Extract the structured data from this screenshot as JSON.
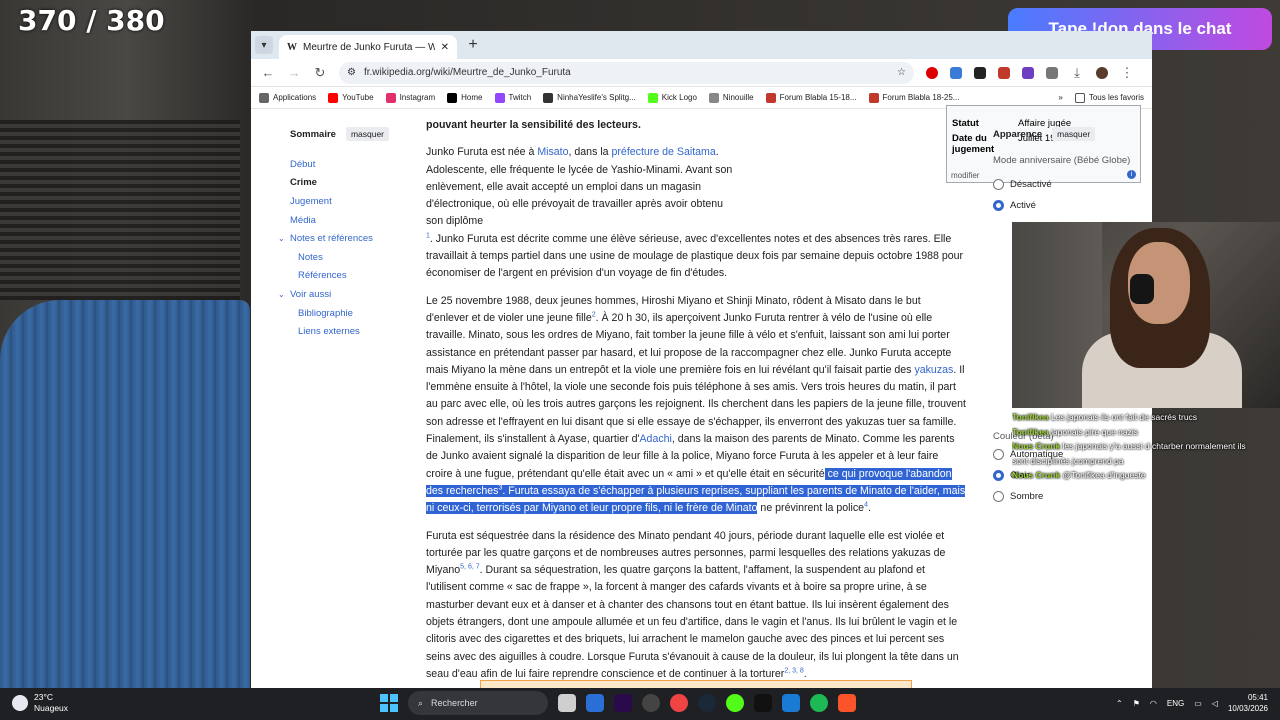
{
  "overlay": {
    "counter": "370 / 380",
    "alert": "Tape !don dans le chat"
  },
  "browser": {
    "tab_title": "Meurtre de Junko Furuta — Wi",
    "url": "fr.wikipedia.org/wiki/Meurtre_de_Junko_Furuta",
    "bookmarks": [
      {
        "label": "Applications",
        "color": "#666"
      },
      {
        "label": "YouTube",
        "color": "#ff0000"
      },
      {
        "label": "Instagram",
        "color": "#e1306c"
      },
      {
        "label": "Home",
        "color": "#000"
      },
      {
        "label": "Twitch",
        "color": "#9146ff"
      },
      {
        "label": "NinhaYeslife's Splitg...",
        "color": "#333"
      },
      {
        "label": "Kick Logo",
        "color": "#53fc18"
      },
      {
        "label": "Ninouille",
        "color": "#888"
      },
      {
        "label": "Forum Blabla 15-18...",
        "color": "#c0392b"
      },
      {
        "label": "Forum Blabla 18-25...",
        "color": "#c0392b"
      }
    ],
    "all_bookmarks": "Tous les favoris"
  },
  "toc": {
    "title": "Sommaire",
    "hide": "masquer",
    "items": [
      "Début",
      "Crime",
      "Jugement",
      "Média",
      "Notes et références",
      "Notes",
      "Références",
      "Voir aussi",
      "Bibliographie",
      "Liens externes"
    ]
  },
  "infobox": {
    "row1_label": "Statut",
    "row1_value": "Affaire jugée",
    "row2_label": "Date du jugement",
    "row2_value": "Juillet 1990",
    "edit": "modifier"
  },
  "article": {
    "warning": "pouvant heurter la sensibilité des lecteurs.",
    "p1": {
      "t1": "Junko Furuta est née à ",
      "l1": "Misato",
      "t2": ", dans la ",
      "l2": "préfecture de Saitama",
      "t3": ". Adolescente, elle fréquente le lycée de Yashio-Minami. Avant son enlèvement, elle avait accepté un emploi dans un magasin d'électronique, où elle prévoyait de travailler après avoir obtenu son diplôme",
      "r1": "1",
      "t4": ". Junko Furuta est décrite comme une élève sérieuse, avec d'excellentes notes et des absences très rares. Elle travaillait à temps partiel dans une usine de moulage de plastique deux fois par semaine depuis octobre 1988 pour économiser de l'argent en prévision d'un voyage de fin d'études."
    },
    "p2": {
      "t1": "Le 25 novembre 1988, deux jeunes hommes, Hiroshi Miyano et Shinji Minato, rôdent à Misato dans le but d'enlever et de violer une jeune fille",
      "r1": "2",
      "t2": ". À 20 h 30, ils aperçoivent Junko Furuta rentrer à vélo de l'usine où elle travaille. Minato, sous les ordres de Miyano, fait tomber la jeune fille à vélo et s'enfuit, laissant son ami lui porter assistance en prétendant passer par hasard, et lui propose de la raccompagner chez elle. Junko Furuta accepte mais Miyano la mène dans un entrepôt et la viole une première fois en lui révélant qu'il faisait partie des ",
      "l1": "yakuzas",
      "t3": ". Il l'emmène ensuite à l'hôtel, la viole une seconde fois puis téléphone à ses amis. Vers trois heures du matin, il part au parc avec elle, où les trois autres garçons les rejoignent. Ils cherchent dans les papiers de la jeune fille, trouvent son adresse et l'effrayent en lui disant que si elle essaye de s'échapper, ils enverront des yakuzas tuer sa famille. Finalement, ils s'installent à Ayase, quartier d'",
      "l2": "Adachi",
      "t4": ", dans la maison des parents de Minato. Comme les parents de Junko avaient signalé la disparition de leur fille à la police, Miyano force Furuta à les appeler et à leur faire croire à une fugue, prétendant qu'elle était avec un « ami » et qu'elle était en sécurité",
      "s1": " ce qui provoque l'abandon des recherches",
      "r2": "3",
      "s2": ". Furuta essaya de s'échapper à plusieurs reprises, suppliant les parents de Minato de l'aider, mais ni ceux-ci, terrorisés par Miyano et leur propre fils, ni le frère de Minato",
      "t5": " ne prévinrent la police",
      "r3": "4",
      "t6": "."
    },
    "p3": {
      "t1": "Furuta est séquestrée dans la résidence des Minato pendant 40 jours, période durant laquelle elle est violée et torturée par les quatre garçons et de nombreuses autres personnes, parmi lesquelles des relations yakuzas de Miyano",
      "r1": "5, 6, 7",
      "t2": ". Durant sa séquestration, les quatre garçons la battent, l'affament, la suspendent au plafond et l'utilisent comme « sac de frappe », la forcent à manger des cafards vivants et à boire sa propre urine, à se masturber devant eux et à danser et à chanter des chansons tout en étant battue. Ils lui insèrent également des objets étrangers, dont une ampoule allumée et un feu d'artifice, dans le vagin et l'anus. Ils lui brûlent le vagin et le clitoris avec des cigarettes et des briquets, lui arrachent le mamelon gauche avec des pinces et lui percent ses seins avec des aiguilles à coudre. Lorsque Furuta s'évanouit à cause de la douleur, ils lui plongent la tête dans un seau d'eau afin de lui faire reprendre conscience et de continuer à la torturer",
      "r2": "2, 3, 8",
      "t3": "."
    }
  },
  "appearance": {
    "title": "Apparence",
    "hide": "masquer",
    "mode_label": "Mode anniversaire (Bébé Globe)",
    "opt_off": "Désactivé",
    "opt_on": "Activé",
    "color_label": "Couleur (bêta)",
    "color_auto": "Automatique",
    "color_light": "Clair",
    "color_dark": "Sombre"
  },
  "chat": [
    {
      "user": "Tonifikea",
      "msg": "Les japonais ils ont fait de sacrés trucs"
    },
    {
      "user": "Tonifikea",
      "msg": "japonais pire que nazis"
    },
    {
      "user": "Nous Crunk",
      "msg": "les japonais y'a aussi d chtarber normalement ils"
    },
    {
      "user": "",
      "msg": "sont disciplinés jcomprend pa"
    },
    {
      "user": "Nous Crunk",
      "msg": "@Tonifikea d'ingueste"
    }
  ],
  "taskbar": {
    "temp": "23°C",
    "weather": "Nuageux",
    "search": "Rechercher",
    "lang": "ENG",
    "time": "05:41",
    "date": "10/03/2026"
  }
}
